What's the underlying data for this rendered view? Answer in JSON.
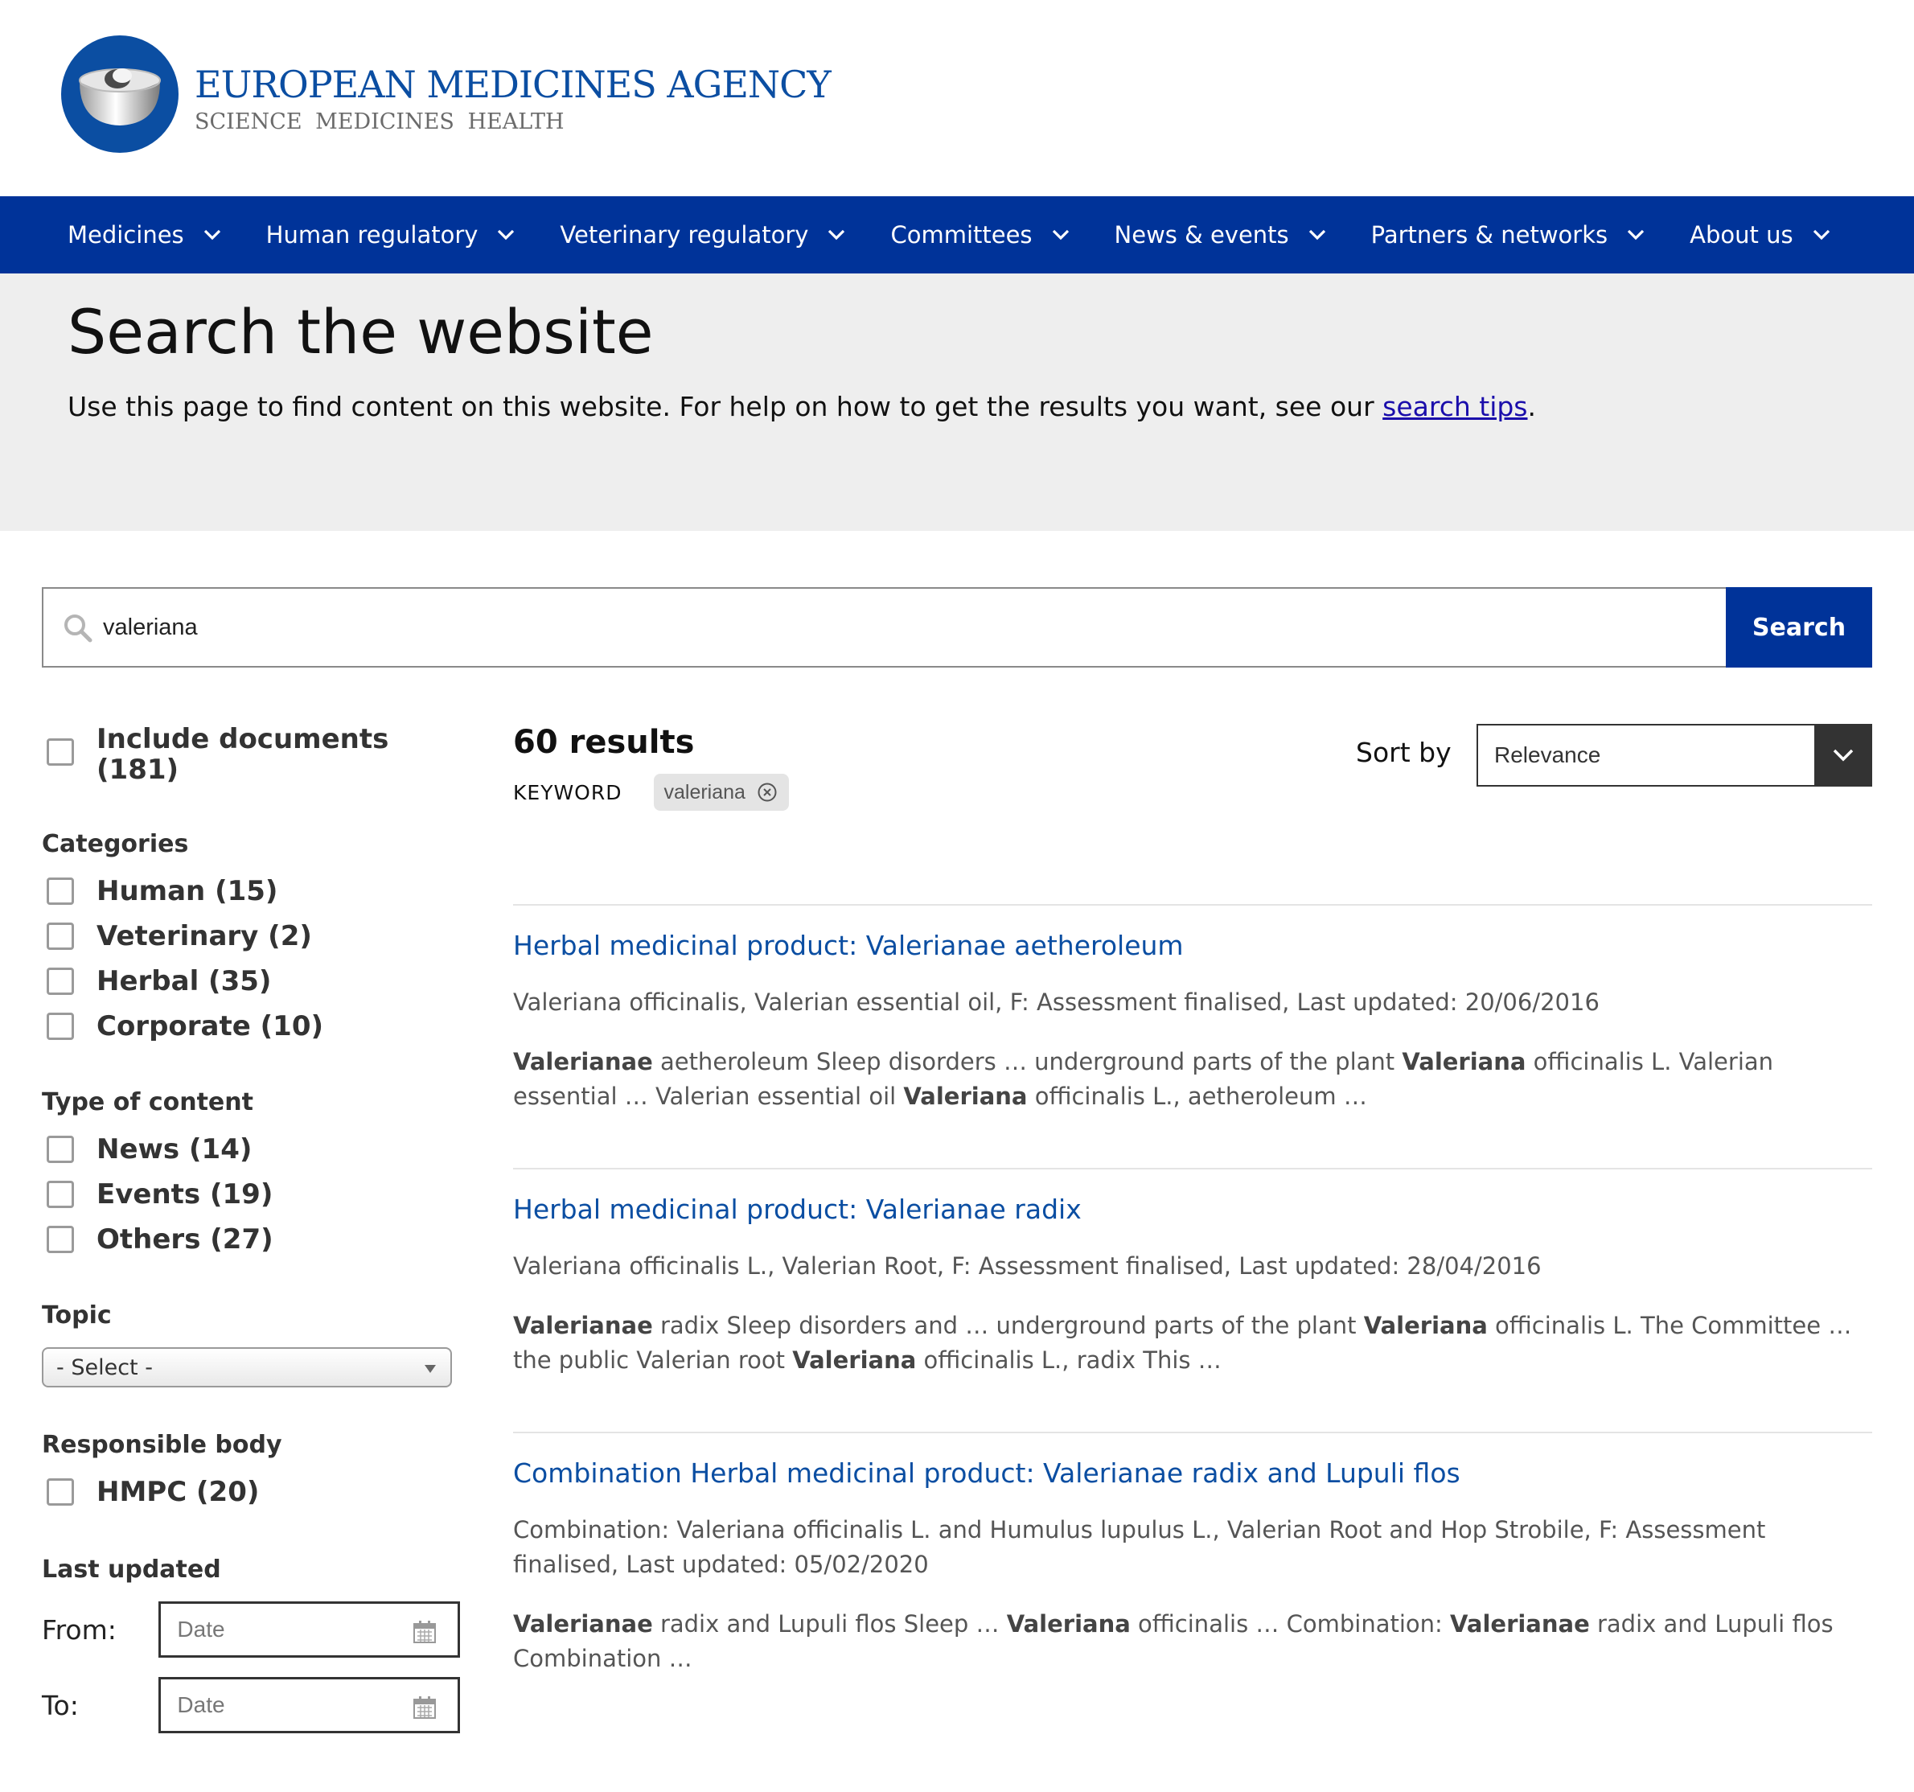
{
  "brand": {
    "name": "EUROPEAN MEDICINES AGENCY",
    "tagline": "SCIENCE  MEDICINES  HEALTH",
    "logo_color": "#0b4ea2"
  },
  "nav": {
    "items": [
      {
        "label": "Medicines"
      },
      {
        "label": "Human regulatory"
      },
      {
        "label": "Veterinary regulatory"
      },
      {
        "label": "Committees"
      },
      {
        "label": "News & events"
      },
      {
        "label": "Partners & networks"
      },
      {
        "label": "About us"
      }
    ],
    "background": "#003399"
  },
  "hero": {
    "title": "Search the website",
    "intro_before": "Use this page to find content on this website. For help on how to get the results you want, see our ",
    "intro_link": "search tips",
    "intro_after": "."
  },
  "search": {
    "value": "valeriana",
    "button_label": "Search",
    "icon": "search-icon"
  },
  "filters": {
    "include_documents": "Include documents (181)",
    "categories": {
      "heading": "Categories",
      "options": [
        "Human (15)",
        "Veterinary (2)",
        "Herbal (35)",
        "Corporate (10)"
      ]
    },
    "type_of_content": {
      "heading": "Type of content",
      "options": [
        "News (14)",
        "Events (19)",
        "Others (27)"
      ]
    },
    "topic": {
      "heading": "Topic",
      "selected": "- Select -"
    },
    "responsible_body": {
      "heading": "Responsible body",
      "options": [
        "HMPC (20)"
      ]
    },
    "last_updated": {
      "heading": "Last updated",
      "from_label": "From:",
      "to_label": "To:",
      "placeholder": "Date",
      "icon": "calendar-icon"
    }
  },
  "results": {
    "count_label": "60 results",
    "keyword_label": "KEYWORD",
    "keyword_chip": "valeriana",
    "sort_label": "Sort by",
    "sort_selected": "Relevance",
    "items": [
      {
        "title": "Herbal medicinal product: Valerianae aetheroleum",
        "meta": "Valeriana officinalis, Valerian essential oil, F: Assessment finalised, Last updated: 20/06/2016",
        "snippet": [
          {
            "b": true,
            "t": "Valerianae"
          },
          {
            "b": false,
            "t": " aetheroleum Sleep disorders … underground parts of the plant "
          },
          {
            "b": true,
            "t": "Valeriana"
          },
          {
            "b": false,
            "t": " officinalis L. Valerian essential … Valerian essential oil "
          },
          {
            "b": true,
            "t": "Valeriana"
          },
          {
            "b": false,
            "t": " officinalis L., aetheroleum …"
          }
        ]
      },
      {
        "title": "Herbal medicinal product: Valerianae radix",
        "meta": "Valeriana officinalis L., Valerian Root, F: Assessment finalised, Last updated: 28/04/2016",
        "snippet": [
          {
            "b": true,
            "t": "Valerianae"
          },
          {
            "b": false,
            "t": " radix Sleep disorders and … underground parts of the plant "
          },
          {
            "b": true,
            "t": "Valeriana"
          },
          {
            "b": false,
            "t": " officinalis L. The Committee … the public Valerian root "
          },
          {
            "b": true,
            "t": "Valeriana"
          },
          {
            "b": false,
            "t": " officinalis L., radix This …"
          }
        ]
      },
      {
        "title": "Combination Herbal medicinal product: Valerianae radix and Lupuli flos",
        "meta": "Combination: Valeriana officinalis L. and Humulus lupulus L., Valerian Root and Hop Strobile, F: Assessment finalised, Last updated: 05/02/2020",
        "snippet": [
          {
            "b": true,
            "t": "Valerianae"
          },
          {
            "b": false,
            "t": " radix and Lupuli flos Sleep … "
          },
          {
            "b": true,
            "t": "Valeriana"
          },
          {
            "b": false,
            "t": " officinalis … Combination: "
          },
          {
            "b": true,
            "t": "Valerianae"
          },
          {
            "b": false,
            "t": " radix and Lupuli flos Combination …"
          }
        ]
      }
    ]
  }
}
